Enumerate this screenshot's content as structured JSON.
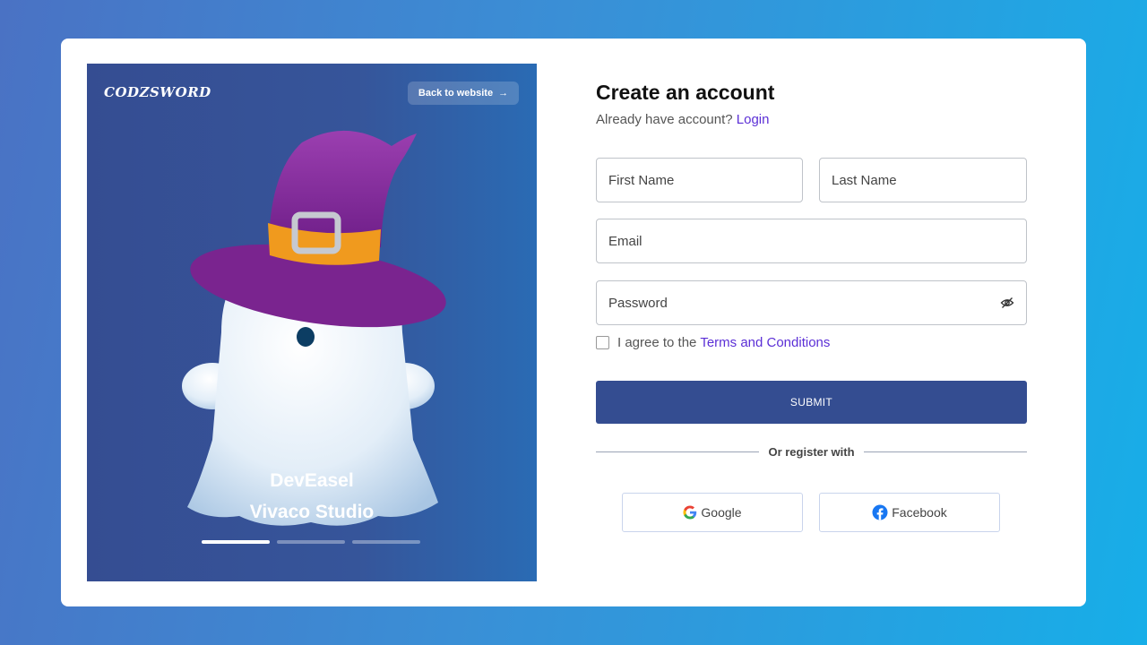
{
  "hero": {
    "brand": "CODZSWORD",
    "back_label": "Back to website",
    "caption_line1": "DevEasel",
    "caption_line2": "Vivaco Studio",
    "slides": [
      {
        "active": true
      },
      {
        "active": false
      },
      {
        "active": false
      }
    ]
  },
  "form": {
    "title": "Create an account",
    "subtitle_prefix": "Already have account?",
    "login_link": "Login",
    "first_name_placeholder": "First Name",
    "last_name_placeholder": "Last Name",
    "email_placeholder": "Email",
    "password_placeholder": "Password",
    "agree_prefix": "I agree to the",
    "terms_link": "Terms and Conditions",
    "submit_label": "SUBMIT",
    "divider_text": "Or register with",
    "google_label": "Google",
    "facebook_label": "Facebook"
  },
  "colors": {
    "accent": "#344d91",
    "link": "#5b2fd6",
    "hero_bg": "#36559a"
  }
}
